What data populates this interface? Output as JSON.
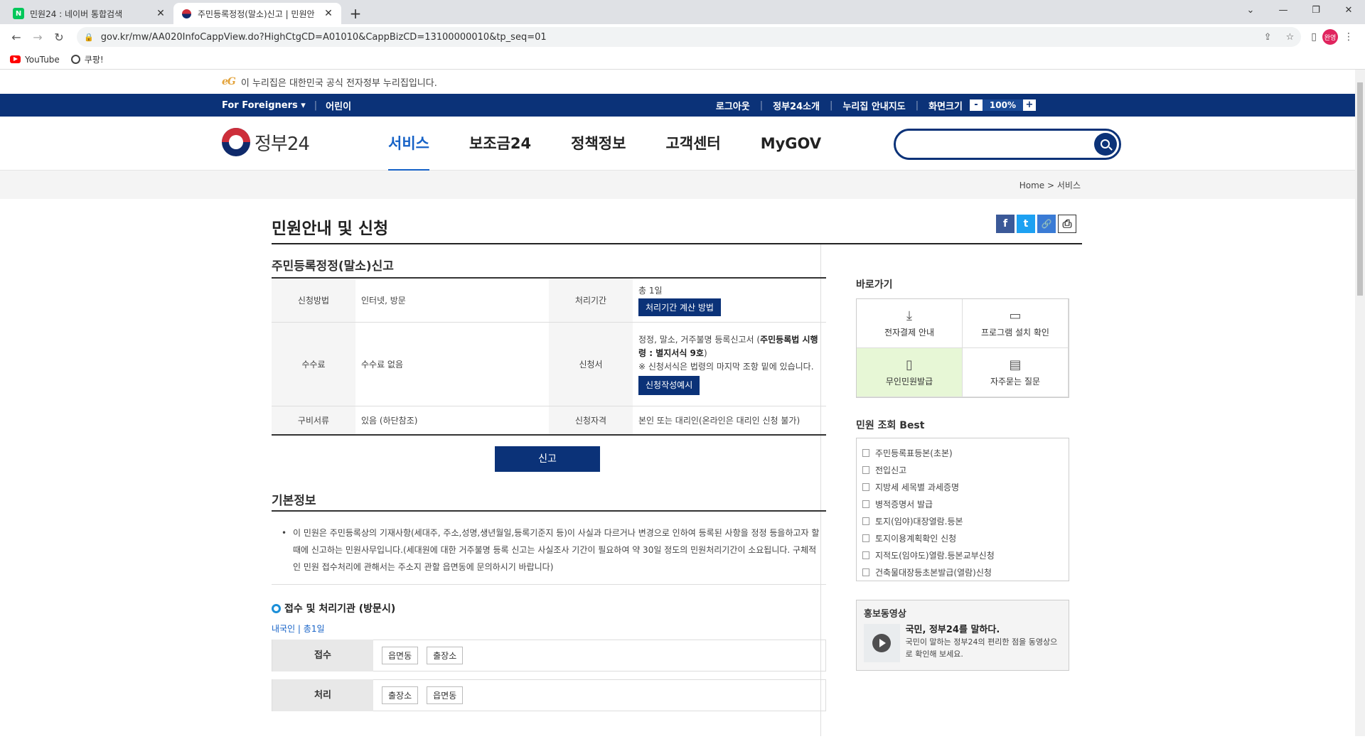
{
  "browser": {
    "tabs": [
      {
        "title": "민원24 : 네이버 통합검색",
        "favicon": "N",
        "active": false
      },
      {
        "title": "주민등록정정(말소)신고 | 민원안",
        "favicon": "gov24",
        "active": true
      }
    ],
    "url": "gov.kr/mw/AA020InfoCappView.do?HighCtgCD=A01010&CappBizCD=13100000010&tp_seq=01",
    "bookmarks": [
      "YouTube",
      "쿠팡!"
    ],
    "avatar_text": "완영"
  },
  "notice": {
    "logo": "eG",
    "text": "이 누리집은 대한민국 공식 전자정부 누리집입니다."
  },
  "topbar": {
    "foreigners": "For Foreigners",
    "kids": "어린이",
    "logout": "로그아웃",
    "about": "정부24소개",
    "sitemap": "누리집 안내지도",
    "screen_size": "화면크기",
    "zoom_minus": "-",
    "zoom_value": "100%",
    "zoom_plus": "+"
  },
  "header": {
    "logo_text": "정부24",
    "menu": [
      "서비스",
      "보조금24",
      "정책정보",
      "고객센터",
      "MyGOV"
    ],
    "search_placeholder": ""
  },
  "breadcrumb": {
    "home": "Home",
    "sep": ">",
    "current": "서비스"
  },
  "page_title": "민원안내 및 신청",
  "share": {
    "facebook": "f",
    "twitter": "t",
    "link": "🔗",
    "print": "⎙"
  },
  "service": {
    "title": "주민등록정정(말소)신고",
    "rows": {
      "method_label": "신청방법",
      "method": "인터넷, 방문",
      "period_label": "처리기간",
      "period": "총 1일",
      "period_btn": "처리기간 계산 방법",
      "fee_label": "수수료",
      "fee": "수수료 없음",
      "form_label": "신청서",
      "form_text1": "정정, 말소, 거주불명 등록신고서 (",
      "form_bold": "주민등록법 시행령 : 별지서식 9호",
      "form_text2": ")",
      "form_note": "※ 신청서식은 법령의 마지막 조항 밑에 있습니다.",
      "form_btn": "신청작성예시",
      "docs_label": "구비서류",
      "docs": "있음 (하단참조)",
      "qual_label": "신청자격",
      "qual": "본인 또는 대리인(온라인은 대리인 신청 불가)"
    },
    "apply_btn": "신고"
  },
  "basic": {
    "title": "기본정보",
    "text": "이 민원은 주민등록상의 기재사항(세대주, 주소,성명,생년월일,등록기준지 등)이 사실과 다르거나 변경으로 인하여 등록된 사항을 정정 등을하고자 할 때에 신고하는 민원사무입니다.(세대원에 대한 거주불명 등록 신고는 사실조사 기간이 필요하여 약 30일 정도의 민원처리기간이 소요됩니다. 구체적인 민원 접수처리에 관해서는 주소지 관할 읍면동에 문의하시기 바랍니다)",
    "sub_title": "접수 및 처리기관 (방문시)",
    "sub_note": "내국인 | 총1일",
    "receive_label": "접수",
    "receive": [
      "읍면동",
      "출장소"
    ],
    "process_label": "처리",
    "process": [
      "출장소",
      "읍면동"
    ]
  },
  "sidebar": {
    "quick_title": "바로가기",
    "quick": [
      {
        "label": "전자결제 안내",
        "icon": "download-icon"
      },
      {
        "label": "프로그램 설치 확인",
        "icon": "monitor-icon"
      },
      {
        "label": "무인민원발급",
        "icon": "kiosk-icon"
      },
      {
        "label": "자주묻는 질문",
        "icon": "chat-icon"
      }
    ],
    "best_title": "민원 조회 Best",
    "best": [
      "주민등록표등본(초본)",
      "전입신고",
      "지방세 세목별 과세증명",
      "병적증명서 발급",
      "토지(임야)대장열람.등본",
      "토지이용계획확인 신청",
      "지적도(임야도)열람.등본교부신청",
      "건축물대장등초본발급(열람)신청"
    ],
    "video_title": "홍보동영상",
    "video_headline": "국민, 정부24를 말하다.",
    "video_desc": "국민이 말하는 정부24의 편리한 점을 동영상으로 확인해 보세요."
  },
  "colors": {
    "navy": "#0b3278",
    "accent": "#1662c7"
  }
}
